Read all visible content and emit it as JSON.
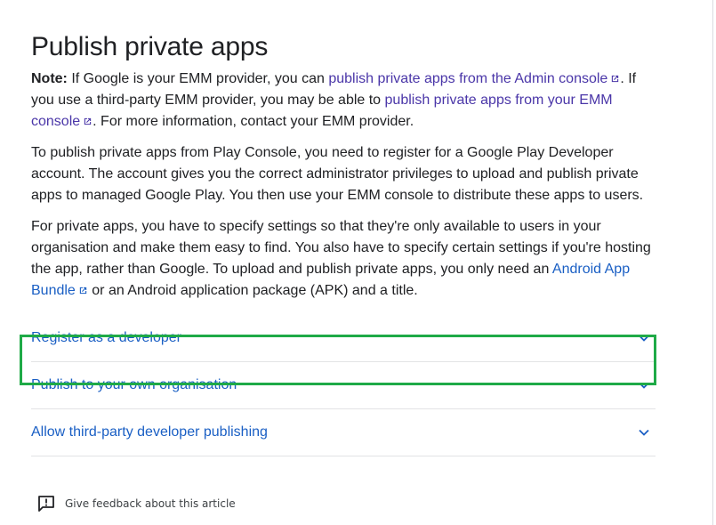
{
  "article": {
    "title": "Publish private apps",
    "note": {
      "label": "Note:",
      "text1": " If Google is your EMM provider, you can ",
      "link1": "publish private apps from the Admin console",
      "text2": ". If you use a third-party EMM provider, you may be able to ",
      "link2": "publish private apps from your EMM console",
      "text3": ". For more information, contact your EMM provider."
    },
    "paragraph1": "To publish private apps from Play Console, you need to register for a Google Play Developer account. The account gives you the correct administrator privileges to upload and publish private apps to managed Google Play. You then use your EMM console to distribute these apps to users.",
    "paragraph2": {
      "text1": "For private apps, you have to specify settings so that they're only available to users in your organisation and make them easy to find. You also have to specify certain settings if you're hosting the app, rather than Google. To upload and publish private apps, you only need an ",
      "link": "Android App Bundle",
      "text2": " or an Android application package (APK) and a title."
    }
  },
  "accordion": {
    "items": [
      {
        "title": "Register as a developer",
        "highlighted": true
      },
      {
        "title": "Publish to your own organisation",
        "highlighted": false
      },
      {
        "title": "Allow third-party developer publishing",
        "highlighted": false
      }
    ],
    "icon": "chevron-down-icon"
  },
  "feedback": {
    "label": "Give feedback about this article",
    "icon": "feedback-icon"
  },
  "colors": {
    "link_purple": "#4a36a8",
    "link_blue": "#1a5fc4",
    "highlight": "#1faa47",
    "text": "#202124"
  }
}
